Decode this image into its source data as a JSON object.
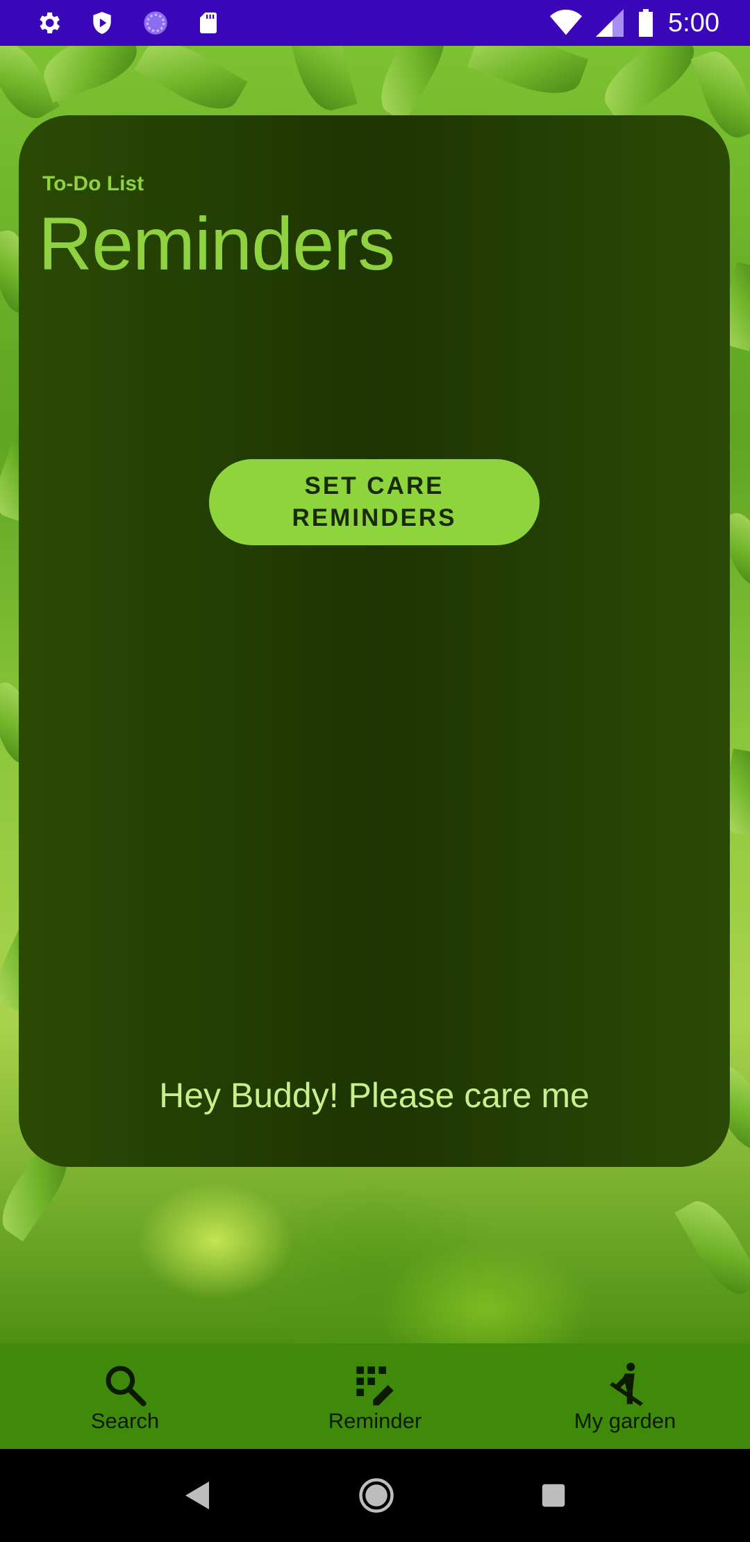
{
  "status_bar": {
    "time": "5:00",
    "left_icons": [
      "settings-icon",
      "shield-play-icon",
      "sync-circle-icon",
      "sd-card-icon"
    ],
    "right_icons": [
      "wifi-icon",
      "signal-icon",
      "battery-icon"
    ]
  },
  "card": {
    "subtitle": "To-Do List",
    "title": "Reminders",
    "button_label": "SET CARE\nREMINDERS",
    "message": "Hey Buddy! Please care me"
  },
  "bottom_nav": {
    "items": [
      {
        "label": "Search",
        "icon": "search-icon"
      },
      {
        "label": "Reminder",
        "icon": "reminder-grid-icon"
      },
      {
        "label": "My garden",
        "icon": "gardener-icon"
      }
    ]
  },
  "system_nav": {
    "icons": [
      "back-icon",
      "home-icon",
      "recents-icon"
    ]
  },
  "colors": {
    "status_bar": "#3a08b8",
    "card_bg": "#1d3502",
    "accent_green": "#8fd13e",
    "button_bg": "#8ed43c",
    "nav_bg": "#3f8a0a",
    "message_text": "#c9f08c"
  }
}
